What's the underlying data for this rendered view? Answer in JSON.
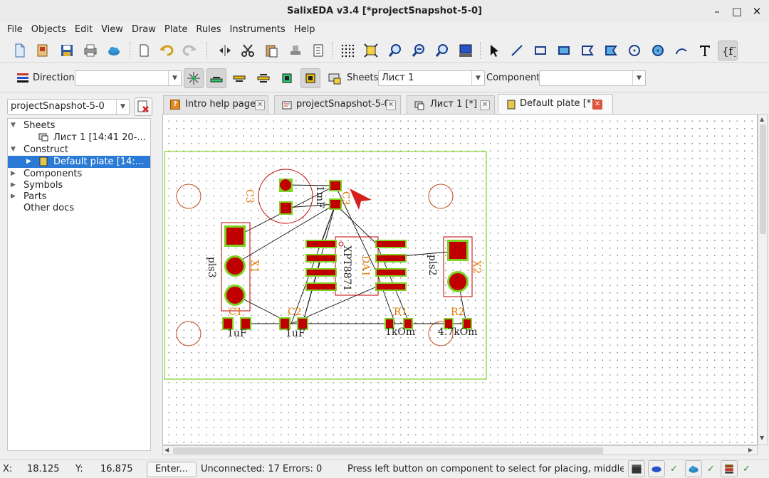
{
  "window": {
    "title": "SalixEDA v3.4 [*projectSnapshot-5-0]"
  },
  "menu": [
    "File",
    "Objects",
    "Edit",
    "View",
    "Draw",
    "Plate",
    "Rules",
    "Instruments",
    "Help"
  ],
  "toolbar2": {
    "direction_label": "Direction:",
    "direction_value": "",
    "sheets_label": "Sheets:",
    "sheets_value": "Лист 1",
    "component_label": "Component:",
    "component_value": ""
  },
  "project_combo": "projectSnapshot-5-0",
  "tree": {
    "sheets": "Sheets",
    "sheet1": "Лист 1 [14:41 20-...",
    "construct": "Construct",
    "default_plate": "Default plate [14:...",
    "components": "Components",
    "symbols": "Symbols",
    "parts": "Parts",
    "other_docs": "Other docs"
  },
  "tabs": [
    {
      "label": "Intro help page"
    },
    {
      "label": "projectSnapshot-5-0"
    },
    {
      "label": "Лист 1 [*]"
    },
    {
      "label": "Default plate [*]"
    }
  ],
  "pcb": {
    "c3_ref": "C3",
    "c3_value": "1mF",
    "x1_ref": "X1",
    "x1_value": "pls3",
    "x2_ref": "X2",
    "x2_value": "pls2",
    "da1_ref": "DA1",
    "da1_value": "XPT8871",
    "c1_ref": "C1",
    "c1_value": "1uF",
    "c2_ref": "C2",
    "c2_value": "1uF",
    "r1_ref": "R1",
    "r1_value": "1kOm",
    "r2_ref": "R2",
    "r2_value": "4.7kOm",
    "c3b_ref": "C3"
  },
  "status": {
    "x_label": "X:",
    "x_value": "18.125",
    "y_label": "Y:",
    "y_value": "16.875",
    "enter_button": "Enter...",
    "unconnected": "Unconnected: 17  Errors: 0",
    "hint": "Press left button on component to select for placing, middle buttc"
  },
  "colors": {
    "board_outline": "#7ed321",
    "pad": "#c00000",
    "silk": "#e07a00",
    "selection": "#2b7bd6"
  }
}
